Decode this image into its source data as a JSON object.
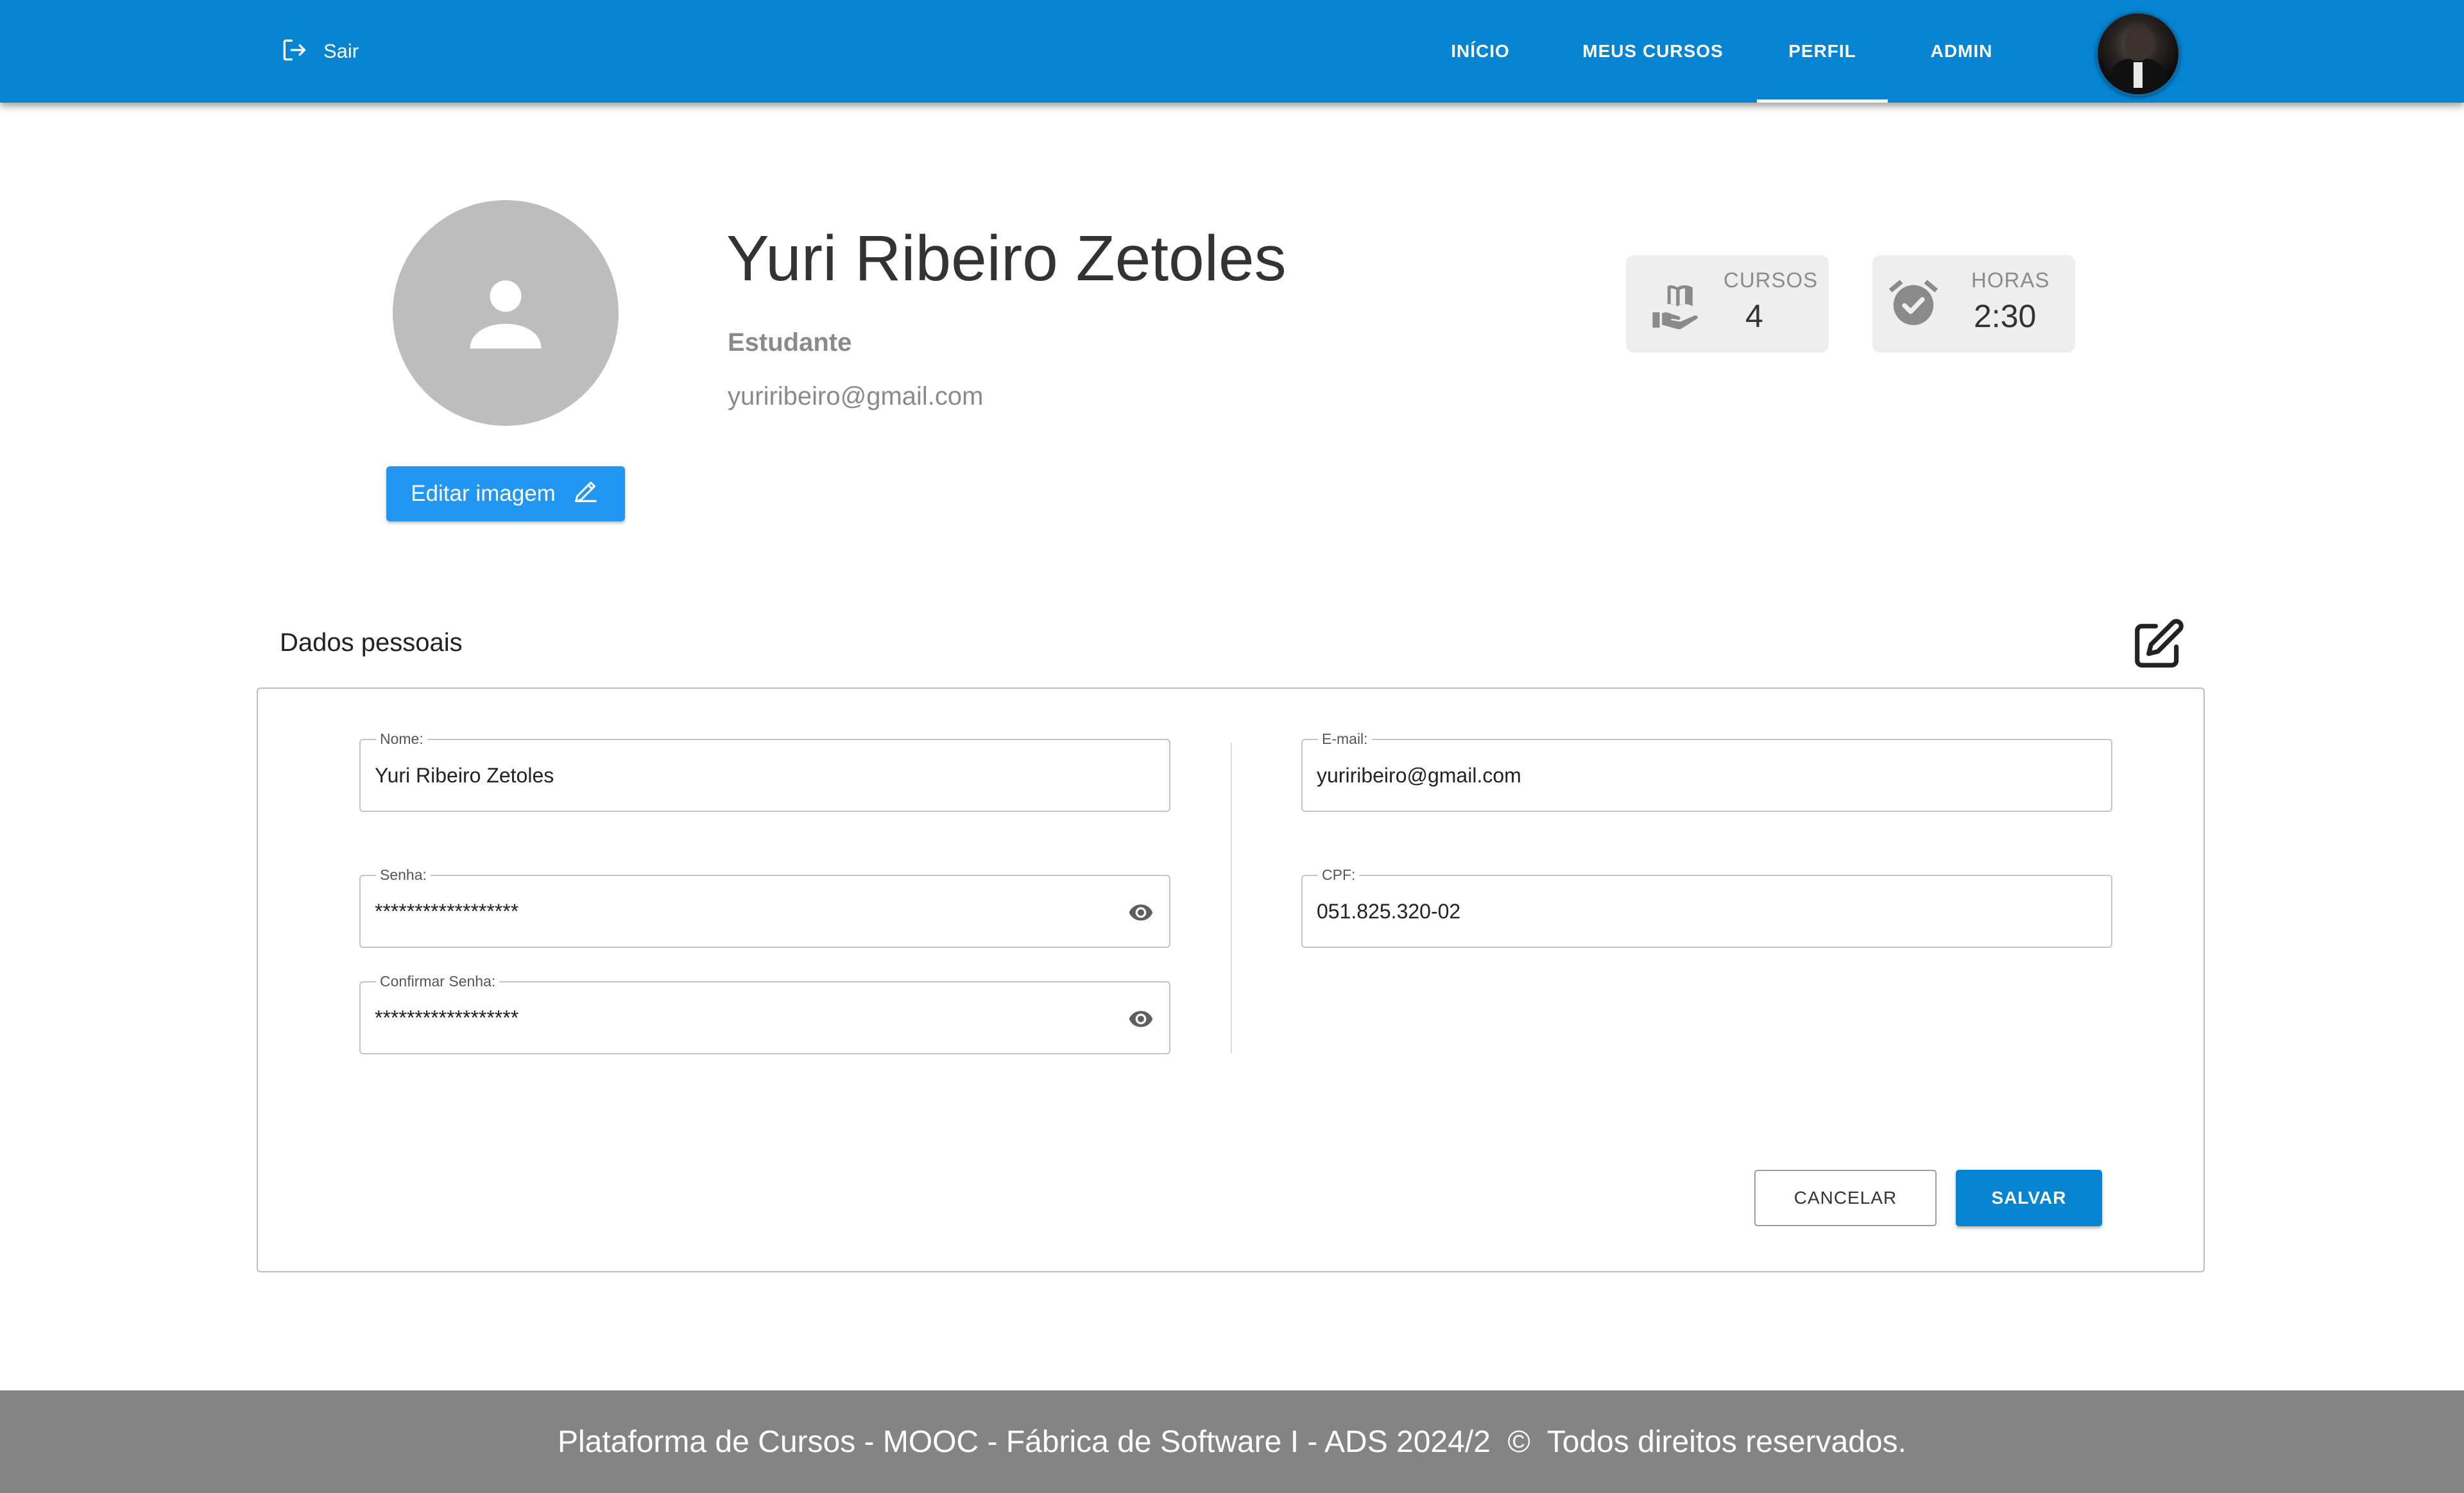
{
  "appbar": {
    "logout_label": "Sair",
    "nav": [
      {
        "label": "INÍCIO",
        "active": false
      },
      {
        "label": "MEUS CURSOS",
        "active": false
      },
      {
        "label": "PERFIL",
        "active": true
      },
      {
        "label": "ADMIN",
        "active": false
      }
    ],
    "color": "#0584d2"
  },
  "profile": {
    "name": "Yuri Ribeiro Zetoles",
    "role": "Estudante",
    "email": "yuriribeiro@gmail.com",
    "edit_image_label": "Editar imagem",
    "stats": [
      {
        "icon": "book-hand-icon",
        "label": "CURSOS",
        "value": "4"
      },
      {
        "icon": "alarm-clock-icon",
        "label": "HORAS",
        "value": "2:30"
      }
    ]
  },
  "personal_data": {
    "title": "Dados pessoais",
    "fields": {
      "name": {
        "label": "Nome:",
        "value": "Yuri Ribeiro Zetoles"
      },
      "password": {
        "label": "Senha:",
        "value": "******************"
      },
      "confirm_password": {
        "label": "Confirmar Senha:",
        "value": "******************"
      },
      "email": {
        "label": "E-mail:",
        "value": "yuriribeiro@gmail.com"
      },
      "cpf": {
        "label": "CPF:",
        "value": "051.825.320-02"
      }
    },
    "cancel_label": "CANCELAR",
    "save_label": "SALVAR"
  },
  "footer": {
    "text": "Plataforma de Cursos - MOOC - Fábrica de Software I - ADS 2024/2  ©  Todos direitos reservados."
  }
}
